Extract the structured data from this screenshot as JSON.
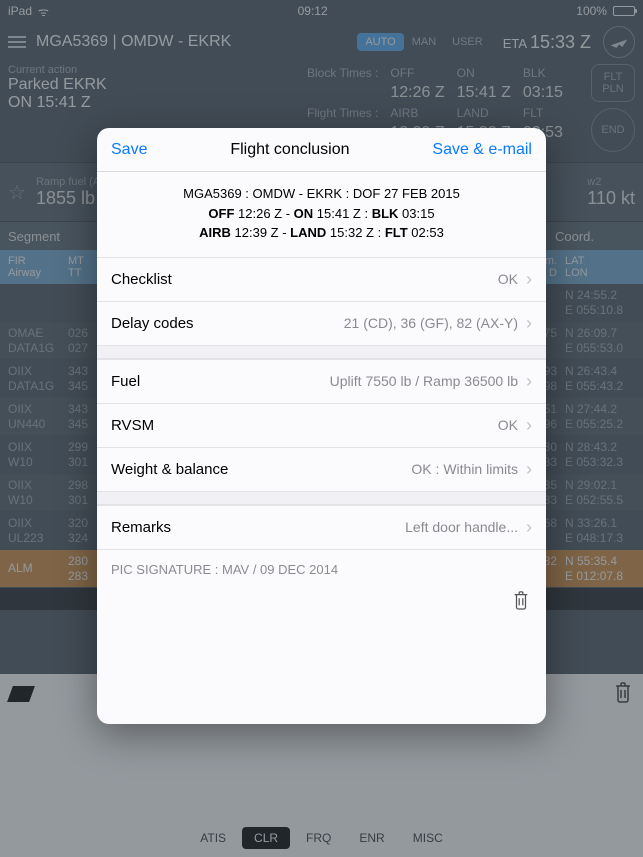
{
  "status": {
    "device": "iPad",
    "time": "09:12",
    "battery": "100%"
  },
  "nav": {
    "title": "MGA5369  |  OMDW - EKRK",
    "modes": {
      "auto": "AUTO",
      "man": "MAN",
      "user": "USER"
    },
    "eta_label": "ETA",
    "eta_value": "15:33 Z"
  },
  "current": {
    "label": "Current action",
    "line1": "Parked EKRK",
    "line2": "ON 15:41 Z"
  },
  "times": {
    "block_label": "Block Times :",
    "flight_label": "Flight Times :",
    "off_l": "OFF",
    "off_v": "12:26 Z",
    "on_l": "ON",
    "on_v": "15:41 Z",
    "blk_l": "BLK",
    "blk_v": "03:15",
    "airb_l": "AIRB",
    "airb_v": "12:39 Z",
    "land_l": "LAND",
    "land_v": "15:32 Z",
    "flt_l": "FLT",
    "flt_v": "02:53"
  },
  "side": {
    "flt": "FLT",
    "pln": "PLN",
    "end": "END"
  },
  "ramp": {
    "fuel_l": "Ramp fuel (A",
    "fuel_v": "1855 lb",
    "w2_l": "w2",
    "w2_v": "110 kt"
  },
  "seg_header": {
    "segment": "Segment",
    "coord": "Coord."
  },
  "col_head": {
    "fir": "FIR",
    "airway": "Airway",
    "mt": "MT",
    "tt": "TT",
    "m": "m.",
    "d": "D",
    "lat": "LAT",
    "lon": "LON"
  },
  "rows": [
    {
      "a1": "",
      "a2": "",
      "b1": "",
      "b2": "",
      "m1": "",
      "m2": "",
      "c1": "N  24:55.2",
      "c2": "E 055:10.8"
    },
    {
      "a1": "OMAE",
      "a2": "DATA1G",
      "b1": "026",
      "b2": "027",
      "m1": "",
      "m2": "875",
      "c1": "N  26:09.7",
      "c2": "E 055:53.0"
    },
    {
      "a1": "OIIX",
      "a2": "DATA1G",
      "b1": "343",
      "b2": "345",
      "m1": "293",
      "m2": "298",
      "c1": "N  26:43.4",
      "c2": "E 055:43.2"
    },
    {
      "a1": "OIIX",
      "a2": "UN440",
      "b1": "343",
      "b2": "345",
      "m1": "451",
      "m2": "296",
      "c1": "N  27:44.2",
      "c2": "E 055:25.2"
    },
    {
      "a1": "OIIX",
      "a2": "W10",
      "b1": "299",
      "b2": "301",
      "m1": "430",
      "m2": "433",
      "c1": "N  28:43.2",
      "c2": "E 053:32.3"
    },
    {
      "a1": "OIIX",
      "a2": "W10",
      "b1": "298",
      "b2": "301",
      "m1": "435",
      "m2": "433",
      "c1": "N  29:02.1",
      "c2": "E 052:55.5"
    },
    {
      "a1": "OIIX",
      "a2": "UL223",
      "b1": "320",
      "b2": "324",
      "m1": "",
      "m2": "268",
      "c1": "N  33:26.1",
      "c2": "E 048:17.3"
    },
    {
      "a1": "ALM",
      "a2": "",
      "b1": "280",
      "b2": "283",
      "m1": "",
      "m2": "282",
      "c1": "N  55:35.4",
      "c2": "E 012:07.8"
    }
  ],
  "bottom": {
    "atis": "ATIS",
    "clr": "CLR",
    "frq": "FRQ",
    "enr": "ENR",
    "misc": "MISC"
  },
  "modal": {
    "save": "Save",
    "title": "Flight conclusion",
    "save_email": "Save & e-mail",
    "summary_line1": "MGA5369 : OMDW - EKRK : DOF 27 FEB 2015",
    "s2_off_l": "OFF",
    "s2_off_v": " 12:26 Z - ",
    "s2_on_l": "ON",
    "s2_on_v": " 15:41 Z : ",
    "s2_blk_l": "BLK",
    "s2_blk_v": " 03:15",
    "s3_a_l": "AIRB",
    "s3_a_v": " 12:39 Z - ",
    "s3_l_l": "LAND",
    "s3_l_v": " 15:32 Z : ",
    "s3_f_l": "FLT",
    "s3_f_v": " 02:53",
    "rows": {
      "checklist_l": "Checklist",
      "checklist_v": "OK",
      "delay_l": "Delay codes",
      "delay_v": "21 (CD), 36 (GF), 82 (AX-Y)",
      "fuel_l": "Fuel",
      "fuel_v": "Uplift 7550 lb / Ramp 36500 lb",
      "rvsm_l": "RVSM",
      "rvsm_v": "OK",
      "wb_l": "Weight & balance",
      "wb_v": "OK : Within limits",
      "remarks_l": "Remarks",
      "remarks_v": "Left door handle..."
    },
    "signature": "PIC SIGNATURE : MAV / 09 DEC 2014"
  }
}
